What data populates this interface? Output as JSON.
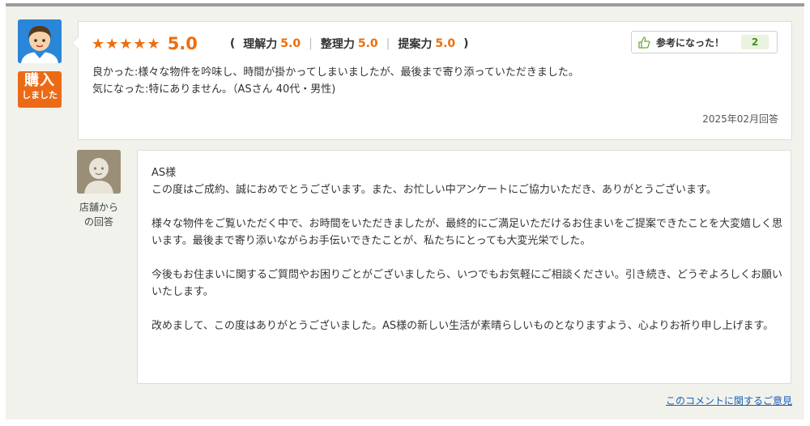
{
  "review": {
    "stars": "★★★★★",
    "score": "5.0",
    "open_paren": "(",
    "close_paren": ")",
    "sub_scores": [
      {
        "label": "理解力",
        "value": "5.0"
      },
      {
        "label": "整理力",
        "value": "5.0"
      },
      {
        "label": "提案力",
        "value": "5.0"
      }
    ],
    "separator": "|",
    "helpful_label": "参考になった！",
    "helpful_count": "2",
    "good_line": "良かった:様々な物件を吟味し、時間が掛かってしまいましたが、最後まで寄り添っていただきました。",
    "concern_line": "気になった:特にありません。（ASさん 40代・男性)",
    "date": "2025年02月回答"
  },
  "badge": {
    "big": "購入",
    "small": "しました"
  },
  "shop": {
    "label_line1": "店舗から",
    "label_line2": "の回答"
  },
  "reply": {
    "greeting": "AS様",
    "p1": "この度はご成約、誠におめでとうございます。また、お忙しい中アンケートにご協力いただき、ありがとうございます。",
    "p2": "様々な物件をご覧いただく中で、お時間をいただきましたが、最終的にご満足いただけるお住まいをご提案できたことを大変嬉しく思います。最後まで寄り添いながらお手伝いできたことが、私たちにとっても大変光栄でした。",
    "p3": "今後もお住まいに関するご質問やお困りごとがございましたら、いつでもお気軽にご相談ください。引き続き、どうぞよろしくお願いいたします。",
    "p4": "改めまして、この度はありがとうございました。AS様の新しい生活が素晴らしいものとなりますよう、心よりお祈り申し上げます。"
  },
  "footer": {
    "opinion_link": "このコメントに関するご意見"
  },
  "colors": {
    "accent_orange": "#ee6d0d",
    "avatar_blue": "#2a86d9",
    "badge_orange": "#ec6a16",
    "shop_icon_brown": "#9a8e77",
    "link_blue": "#1a5fb4",
    "helpful_green": "#4a8c1c"
  },
  "icons": {
    "reviewer": "reviewer-avatar-icon",
    "shop": "shop-staff-icon",
    "helpful": "thumbs-up-hand-icon"
  }
}
